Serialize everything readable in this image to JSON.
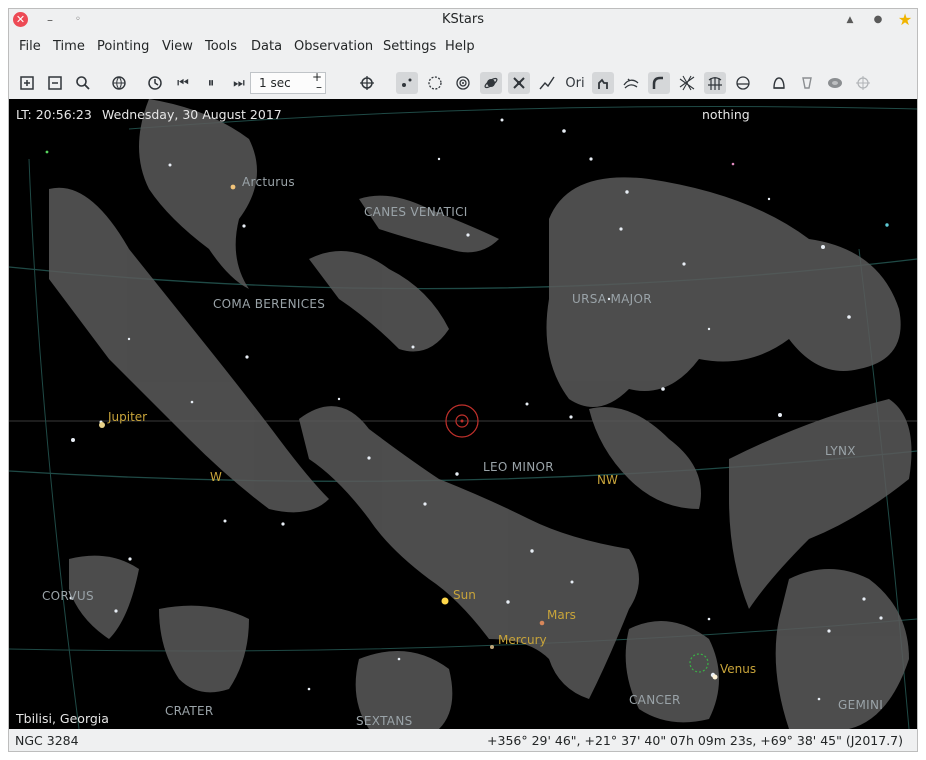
{
  "window": {
    "title": "KStars"
  },
  "menu": [
    "File",
    "Time",
    "Pointing",
    "View",
    "Tools",
    "Data",
    "Observation",
    "Settings",
    "Help"
  ],
  "toolbar": {
    "time_step": "1 sec"
  },
  "sky": {
    "local_time": "LT: 20:56:23",
    "date": "Wednesday, 30 August 2017",
    "focus_object": "nothing",
    "location": "Tbilisi, Georgia",
    "constellations": {
      "canes_venatici": "CANES VENATICI",
      "coma_berenices": "COMA BERENICES",
      "ursa_major": "URSA MAJOR",
      "leo_minor": "LEO MINOR",
      "lynx": "LYNX",
      "corvus": "CORVUS",
      "crater": "CRATER",
      "sextans": "SEXTANS",
      "cancer": "CANCER",
      "gemini": "GEMINI"
    },
    "stars": {
      "arcturus": "Arcturus"
    },
    "planets": {
      "jupiter": "Jupiter",
      "sun": "Sun",
      "mars": "Mars",
      "mercury": "Mercury",
      "venus": "Venus"
    },
    "directions": {
      "w": "W",
      "nw": "NW"
    }
  },
  "status": {
    "object": "NGC 3284",
    "coordinates": "+356° 29' 46\", +21° 37' 40\"  07h 09m 23s, +69° 38' 45\" (J2017.7)"
  },
  "colors": {
    "planet_label": "#c8a43a",
    "constellation_label": "#9aa3a8",
    "target_circle": "#c0302b"
  }
}
